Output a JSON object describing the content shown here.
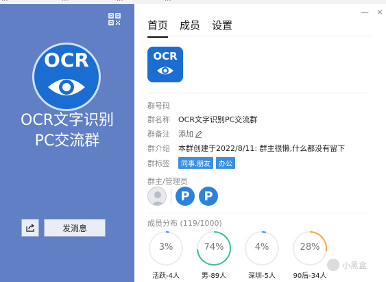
{
  "top_strip": {
    "fragments": [
      "...",
      "...",
      "...",
      "..."
    ]
  },
  "left_panel": {
    "logo_text": "OCR",
    "group_name_line1": "OCR文字识别",
    "group_name_line2": "PC交流群",
    "send_label": "发消息",
    "bg_color": "#607fc4"
  },
  "window": {
    "minimize": "—",
    "close": "✕"
  },
  "tabs": [
    {
      "label": "首页",
      "active": true
    },
    {
      "label": "成员",
      "active": false
    },
    {
      "label": "设置",
      "active": false
    }
  ],
  "group_logo_text": "OCR",
  "info": {
    "id": {
      "key": "群号码",
      "value": ""
    },
    "name": {
      "key": "群名称",
      "value": "OCR文字识别PC交流群"
    },
    "remark": {
      "key": "群备注",
      "value": "添加"
    },
    "intro": {
      "key": "群介绍",
      "value": "本群创建于2022/8/11:  群主很懒,什么都没有留下"
    },
    "tags": {
      "key": "群标签",
      "values": [
        "同事.朋友",
        "办公"
      ]
    }
  },
  "admins": {
    "title": "群主/管理员",
    "avatar_letter": "P"
  },
  "distribution": {
    "title": "成员分布 (119/1000)",
    "items": [
      {
        "pct": "3%",
        "fraction": 0.03,
        "label": "活跃-4人",
        "color": "#3a8fe0"
      },
      {
        "pct": "74%",
        "fraction": 0.74,
        "label": "男-89人",
        "color": "#3dbf8b"
      },
      {
        "pct": "4%",
        "fraction": 0.04,
        "label": "深圳-5人",
        "color": "#3a8fe0"
      },
      {
        "pct": "28%",
        "fraction": 0.28,
        "label": "90后-34人",
        "color": "#f3a64a"
      }
    ]
  },
  "watermark": "小黑盒",
  "accent": "#1a6dd2"
}
